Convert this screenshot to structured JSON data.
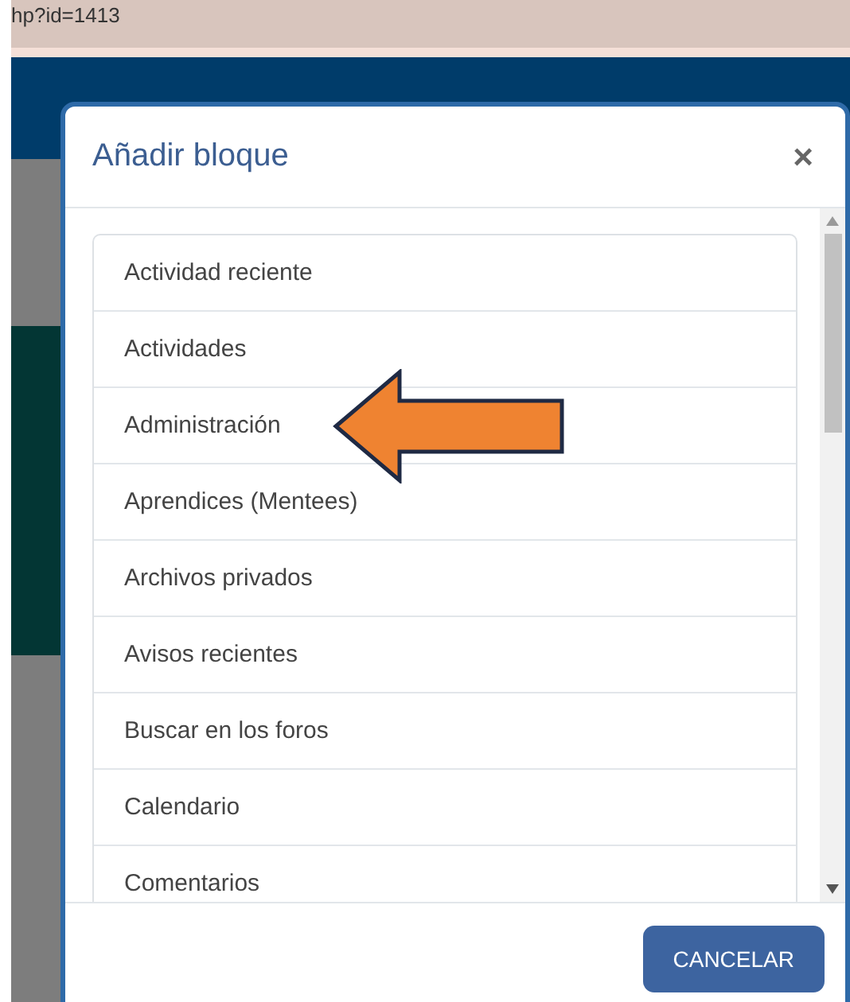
{
  "browser": {
    "url": "hp?id=1413"
  },
  "modal": {
    "title": "Añadir bloque",
    "close": "×",
    "items": [
      {
        "label": "Actividad reciente",
        "pointed": false
      },
      {
        "label": "Actividades",
        "pointed": false
      },
      {
        "label": "Administración",
        "pointed": true
      },
      {
        "label": "Aprendices (Mentees)",
        "pointed": false
      },
      {
        "label": "Archivos privados",
        "pointed": false
      },
      {
        "label": "Avisos recientes",
        "pointed": false
      },
      {
        "label": "Buscar en los foros",
        "pointed": false
      },
      {
        "label": "Calendario",
        "pointed": false
      },
      {
        "label": "Comentarios",
        "pointed": false
      }
    ],
    "buttons": [
      {
        "label": "CANCELAR"
      }
    ]
  }
}
